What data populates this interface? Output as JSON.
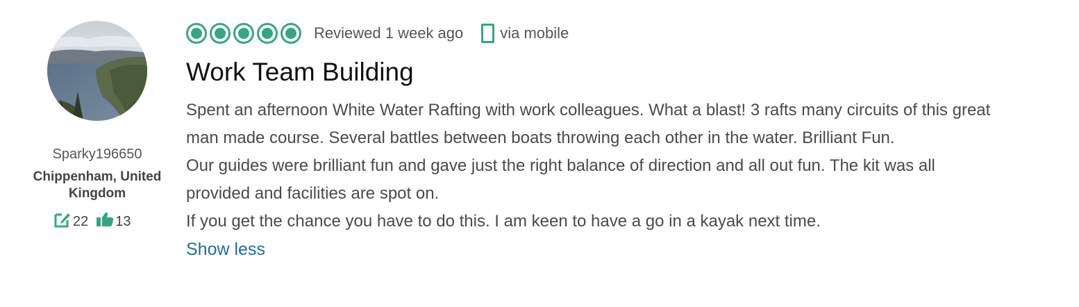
{
  "reviewer": {
    "username": "Sparky196650",
    "location": "Chippenham, United Kingdom",
    "review_count": "22",
    "helpful_votes": "13"
  },
  "review": {
    "rating": 5,
    "rating_max": 5,
    "reviewed_when": "Reviewed 1 week ago",
    "via": "via mobile",
    "title": "Work Team Building",
    "paragraphs": [
      "Spent an afternoon White Water Rafting with work colleagues. What a blast! 3 rafts many circuits of this great man made course. Several battles between boats throwing each other in the water. Brilliant Fun.",
      "Our guides were brilliant fun and gave just the right balance of direction and all out fun. The kit was all provided and facilities are spot on.",
      "If you get the chance you have to do this. I am keen to have a go in a kayak next time."
    ],
    "toggle_label": "Show less"
  },
  "icons": {
    "rating": "bubble-rating-icon",
    "mobile": "mobile-phone-icon",
    "reviews": "review-pencil-icon",
    "helpful": "thumbs-up-icon"
  },
  "colors": {
    "accent": "#34a77e",
    "link": "#1f6ba6",
    "title": "#111111",
    "text": "#4a4a4a"
  }
}
